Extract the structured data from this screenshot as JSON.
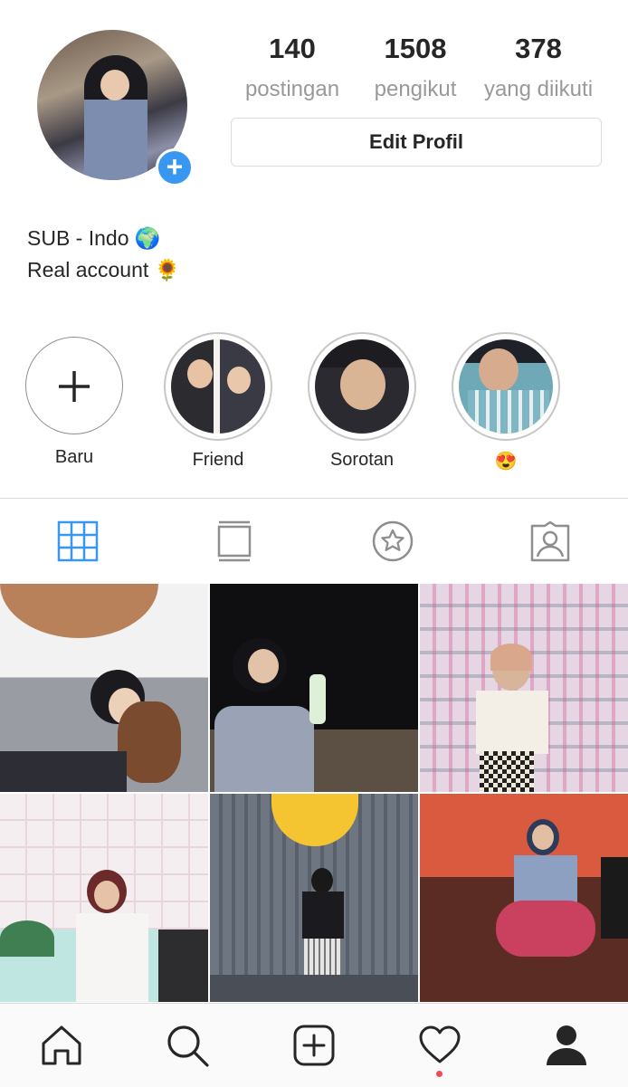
{
  "profile": {
    "stats": [
      {
        "value": "140",
        "label": "postingan"
      },
      {
        "value": "1508",
        "label": "pengikut"
      },
      {
        "value": "378",
        "label": "yang diikuti"
      }
    ],
    "edit_button": "Edit Profil",
    "bio_line1": "SUB - Indo 🌍",
    "bio_line2": "Real account 🌻"
  },
  "highlights": [
    {
      "label": "Baru"
    },
    {
      "label": "Friend"
    },
    {
      "label": "Sorotan"
    },
    {
      "label": "😍"
    }
  ],
  "tabs": [
    "grid-icon",
    "feed-icon",
    "saved-star-icon",
    "tagged-icon"
  ],
  "colors": {
    "accent": "#3897f0",
    "notification": "#ed4956",
    "text": "#262626",
    "muted": "#999999"
  },
  "nav": [
    "home-icon",
    "search-icon",
    "add-post-icon",
    "activity-heart-icon",
    "profile-icon"
  ]
}
